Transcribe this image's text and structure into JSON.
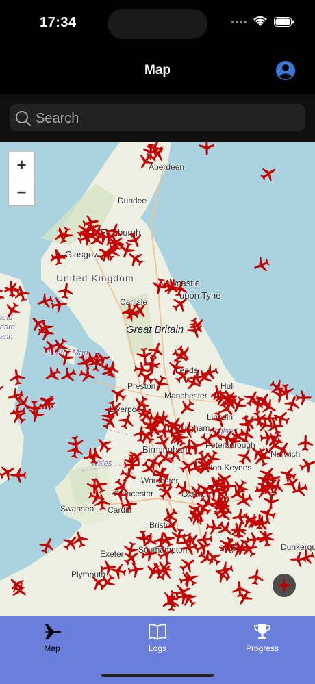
{
  "status": {
    "time": "17:34"
  },
  "nav": {
    "title": "Map"
  },
  "search": {
    "placeholder": "Search"
  },
  "map": {
    "zoom_in": "+",
    "zoom_out": "−",
    "labels": {
      "aberdeen": "Aberdeen",
      "dundee": "Dundee",
      "edinburgh": "Edinburgh",
      "glasgow": "Glasgow",
      "united_kingdom": "United Kingdom",
      "newcastle": "Newcastle",
      "tyne": "upon Tyne",
      "carlisle": "Carlisle",
      "great_britain": "Great Britain",
      "isle_of_man": "Isle of Man",
      "leeds": "Leeds",
      "hull": "Hull",
      "preston": "Preston",
      "liverpool": "Liverpool",
      "manchester": "Manchester",
      "lincoln": "Lincoln",
      "england": "England",
      "nottingham": "Nottingham",
      "peterborough": "Peterborough",
      "norwich": "Norwich",
      "birmingham": "Birmingham",
      "wales": "Wales",
      "milton_keynes": "Milton Keynes",
      "worcester": "Worcester",
      "oxford": "Oxford",
      "gloucester": "Gloucester",
      "swansea": "Swansea",
      "cardiff": "Cardiff",
      "bristol": "Bristol",
      "exeter": "Exeter",
      "southampton": "Southampton",
      "brighton": "Brighton",
      "plymouth": "Plymouth",
      "dunkerque": "Dunkerque",
      "ireland_frag1": "and",
      "ireland_frag2": "earc",
      "ireland_frag3": "ann"
    }
  },
  "tabs": [
    {
      "label": "Map",
      "icon": "airplane-icon",
      "active": true
    },
    {
      "label": "Logs",
      "icon": "book-icon",
      "active": false
    },
    {
      "label": "Progress",
      "icon": "trophy-icon",
      "active": false
    }
  ],
  "colors": {
    "plane": "#c40000",
    "tab_bar": "#6a7fdb",
    "sea": "#aad3df",
    "land": "#eef0e4"
  }
}
